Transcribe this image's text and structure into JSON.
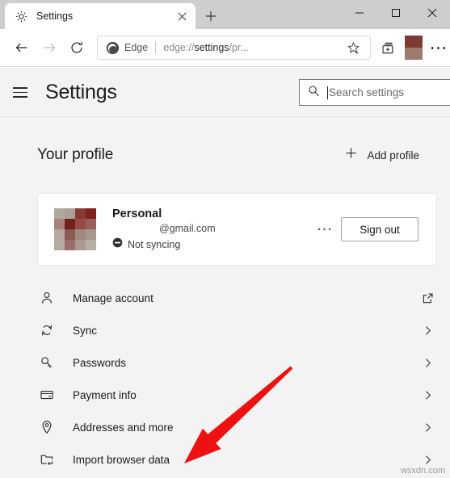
{
  "window": {
    "tab": {
      "title": "Settings",
      "favicon": "gear-icon",
      "close_icon": "close-icon"
    },
    "new_tab_label": "+",
    "controls": {
      "minimize": "—",
      "maximize": "□",
      "close": "✕"
    }
  },
  "toolbar": {
    "back_icon": "back-arrow-icon",
    "forward_icon": "forward-arrow-icon",
    "reload_icon": "reload-icon",
    "edge_label": "Edge",
    "url": "edge://settings/pr...",
    "url_prefix": "edge://",
    "url_bold": "settings",
    "url_suffix": "/pr...",
    "favorite_icon": "star-add-icon",
    "collections_icon": "collections-icon",
    "profile_icon": "profile-avatar",
    "more_icon": "ellipsis-icon"
  },
  "settings_header": {
    "menu_icon": "hamburger-icon",
    "title": "Settings",
    "search": {
      "icon": "search-icon",
      "placeholder": "Search settings",
      "value": ""
    }
  },
  "profile_section": {
    "heading": "Your profile",
    "add_profile": {
      "icon": "plus-icon",
      "label": "Add profile"
    },
    "card": {
      "avatar": "profile-avatar-pixelated",
      "name": "Personal",
      "email": "@gmail.com",
      "sync_status": "Not syncing",
      "sync_icon": "sync-blocked-icon",
      "more_icon": "ellipsis-icon",
      "sign_out_label": "Sign out"
    }
  },
  "settings_list": [
    {
      "icon": "person-icon",
      "label": "Manage account",
      "trailing": "external-link-icon"
    },
    {
      "icon": "sync-icon",
      "label": "Sync",
      "trailing": "chevron-right-icon"
    },
    {
      "icon": "key-icon",
      "label": "Passwords",
      "trailing": "chevron-right-icon"
    },
    {
      "icon": "credit-card-icon",
      "label": "Payment info",
      "trailing": "chevron-right-icon"
    },
    {
      "icon": "location-pin-icon",
      "label": "Addresses and more",
      "trailing": "chevron-right-icon"
    },
    {
      "icon": "import-folder-icon",
      "label": "Import browser data",
      "trailing": "chevron-right-icon"
    }
  ],
  "annotation": {
    "arrow_color": "#ee1111",
    "points_to": "Import browser data"
  },
  "watermark": "wsxdn.com",
  "colors": {
    "page_bg": "#f3f3f3",
    "card_bg": "#ffffff",
    "titlebar_bg": "#cecece",
    "text": "#1b1b1b",
    "arrow": "#ee1111",
    "avatar_swatches": [
      "#b0a79d",
      "#aaa096",
      "#8a3a34",
      "#7e231f",
      "#a9817a",
      "#731f1c",
      "#974a44",
      "#9a5f58",
      "#b3a99f",
      "#8c5a53",
      "#a08a80",
      "#a8978d",
      "#b5aca3",
      "#9b6f68",
      "#ab9a90",
      "#b7aea5"
    ]
  }
}
